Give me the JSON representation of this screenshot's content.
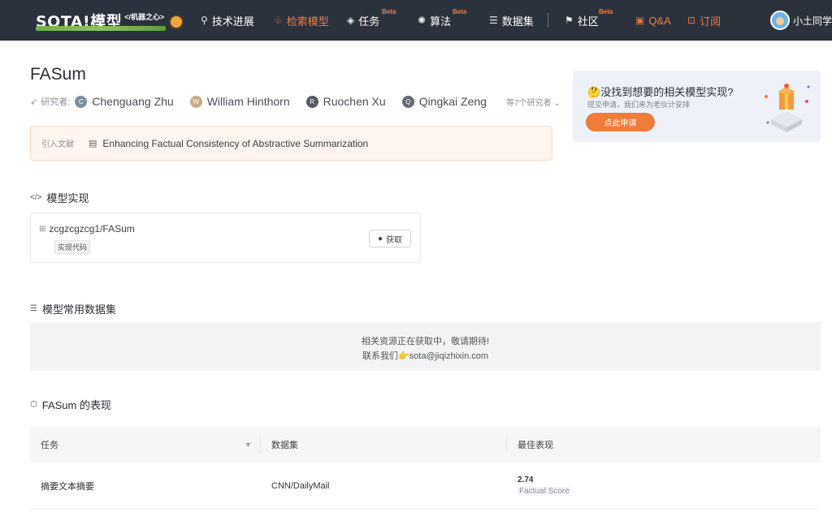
{
  "nav": {
    "logo_text": "SOTA!模型",
    "logo_sub": "</机器之心>",
    "items": [
      {
        "label": "技术进展",
        "icon": "rocket-icon"
      },
      {
        "label": "检索模型",
        "icon": "model-icon"
      },
      {
        "label": "任务",
        "icon": "layers-icon",
        "badge": "Beta"
      },
      {
        "label": "算法",
        "icon": "algorithm-icon",
        "badge": "Beta"
      },
      {
        "label": "数据集",
        "icon": "database-icon"
      },
      {
        "label": "社区",
        "icon": "flag-icon",
        "badge": "Beta"
      },
      {
        "label": "Q&A",
        "icon": "qa-icon"
      },
      {
        "label": "订阅",
        "icon": "bookmark-icon"
      }
    ],
    "user_name": "小土同学"
  },
  "model": {
    "title": "FASum",
    "authors_label": "研究者:",
    "authors": [
      {
        "initial": "C",
        "name": "Chenguang Zhu",
        "color": "#7d8fa3"
      },
      {
        "initial": "W",
        "name": "William Hinthorn",
        "color": "#c9ab86"
      },
      {
        "initial": "R",
        "name": "Ruochen Xu",
        "color": "#555b63"
      },
      {
        "initial": "Q",
        "name": "Qingkai Zeng",
        "color": "#666b73"
      }
    ],
    "authors_more": "等7个研究者",
    "ref_label": "引入文献",
    "ref_text": "Enhancing Factual Consistency of Abstractive Summarization"
  },
  "promo": {
    "title": "没找到想要的相关模型实现?",
    "subtitle": "提交申请，我们来为老伙计安排",
    "button": "点此申请"
  },
  "impl": {
    "section_title": "模型实现",
    "repo": "zcgzcgzcg1/FASum",
    "tag": "实现代码",
    "get_button": "获取"
  },
  "datasets": {
    "section_title": "模型常用数据集",
    "line1": "相关资源正在获取中，敬请期待!",
    "line2_prefix": "联系我们",
    "email": "sota@jiqizhixin.com"
  },
  "performance": {
    "section_title": "FASum 的表现",
    "columns": [
      "任务",
      "数据集",
      "最佳表现"
    ],
    "rows": [
      {
        "task": "摘要文本摘要",
        "dataset": "CNN/DailyMail",
        "score": "2.74",
        "metric": "Factual Score"
      }
    ]
  },
  "colors": {
    "nav_bg": "#2c323d",
    "accent": "#f07c3c"
  }
}
